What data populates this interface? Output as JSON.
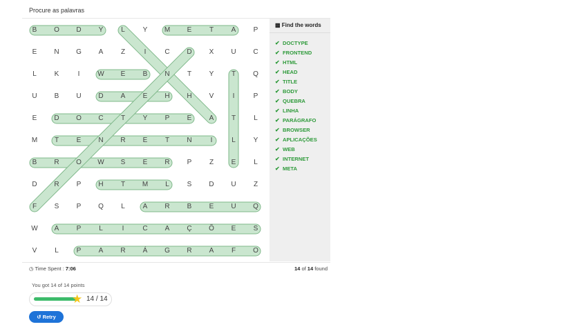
{
  "puzzle": {
    "title": "Procure as palavras",
    "grid": [
      [
        "B",
        "O",
        "D",
        "Y",
        "L",
        "Y",
        "M",
        "E",
        "T",
        "A",
        "P"
      ],
      [
        "E",
        "N",
        "G",
        "A",
        "Z",
        "I",
        "C",
        "D",
        "X",
        "U",
        "C"
      ],
      [
        "L",
        "K",
        "I",
        "W",
        "E",
        "B",
        "N",
        "T",
        "Y",
        "T",
        "Q"
      ],
      [
        "U",
        "B",
        "U",
        "D",
        "A",
        "E",
        "H",
        "H",
        "V",
        "I",
        "P"
      ],
      [
        "E",
        "D",
        "O",
        "C",
        "T",
        "Y",
        "P",
        "E",
        "A",
        "T",
        "L"
      ],
      [
        "M",
        "T",
        "E",
        "N",
        "R",
        "E",
        "T",
        "N",
        "I",
        "L",
        "Y"
      ],
      [
        "B",
        "R",
        "O",
        "W",
        "S",
        "E",
        "R",
        "P",
        "Z",
        "E",
        "L"
      ],
      [
        "D",
        "R",
        "P",
        "H",
        "T",
        "M",
        "L",
        "S",
        "D",
        "U",
        "Z"
      ],
      [
        "F",
        "S",
        "P",
        "Q",
        "L",
        "A",
        "R",
        "B",
        "E",
        "U",
        "Q"
      ],
      [
        "W",
        "A",
        "P",
        "L",
        "I",
        "C",
        "A",
        "Ç",
        "Õ",
        "E",
        "S"
      ],
      [
        "V",
        "L",
        "P",
        "A",
        "R",
        "Á",
        "G",
        "R",
        "A",
        "F",
        "O"
      ]
    ],
    "found_words": [
      {
        "word": "BODY",
        "start": [
          0,
          0
        ],
        "end": [
          0,
          3
        ]
      },
      {
        "word": "LINHA",
        "start": [
          0,
          4
        ],
        "end": [
          4,
          8
        ]
      },
      {
        "word": "META",
        "start": [
          0,
          6
        ],
        "end": [
          0,
          9
        ]
      },
      {
        "word": "WEB",
        "start": [
          2,
          3
        ],
        "end": [
          2,
          5
        ]
      },
      {
        "word": "TITLE",
        "start": [
          2,
          9
        ],
        "end": [
          6,
          9
        ]
      },
      {
        "word": "HEAD",
        "start": [
          3,
          6
        ],
        "end": [
          3,
          3
        ]
      },
      {
        "word": "DOCTYPE",
        "start": [
          4,
          1
        ],
        "end": [
          4,
          7
        ]
      },
      {
        "word": "INTERNET",
        "start": [
          5,
          8
        ],
        "end": [
          5,
          1
        ]
      },
      {
        "word": "BROWSER",
        "start": [
          6,
          0
        ],
        "end": [
          6,
          6
        ]
      },
      {
        "word": "HTML",
        "start": [
          7,
          3
        ],
        "end": [
          7,
          6
        ]
      },
      {
        "word": "QUEBRA",
        "start": [
          8,
          10
        ],
        "end": [
          8,
          5
        ]
      },
      {
        "word": "APLICAÇÕES",
        "start": [
          9,
          1
        ],
        "end": [
          9,
          10
        ]
      },
      {
        "word": "PARÁGRAFO",
        "start": [
          10,
          2
        ],
        "end": [
          10,
          10
        ]
      },
      {
        "word": "FRONTEND",
        "start": [
          8,
          0
        ],
        "end": [
          1,
          7
        ]
      }
    ]
  },
  "sidebar": {
    "heading": "Find the words",
    "heading_icon": "book-icon",
    "words": [
      "DOCTYPE",
      "FRONTEND",
      "HTML",
      "HEAD",
      "TITLE",
      "BODY",
      "QUEBRA",
      "LINHA",
      "PARÁGRAFO",
      "BROWSER",
      "APLICAÇÕES",
      "WEB",
      "INTERNET",
      "META"
    ],
    "check_icon": "check-icon"
  },
  "status": {
    "time_label": "Time Spent : ",
    "time_value": "7:06",
    "found_count": "14",
    "found_of": " of ",
    "found_total": "14",
    "found_suffix": " found"
  },
  "result": {
    "points_text": "You got 14 of 14 points",
    "score_text": "14 / 14",
    "progress": 1.0,
    "retry_label": "Retry"
  },
  "colors": {
    "highlight_fill": "#cfe8d3",
    "highlight_stroke": "#7fb88a",
    "found_word": "#2e9a3a",
    "progress": "#3dbb6a",
    "retry": "#1e73d8",
    "star": "#f5c518"
  }
}
